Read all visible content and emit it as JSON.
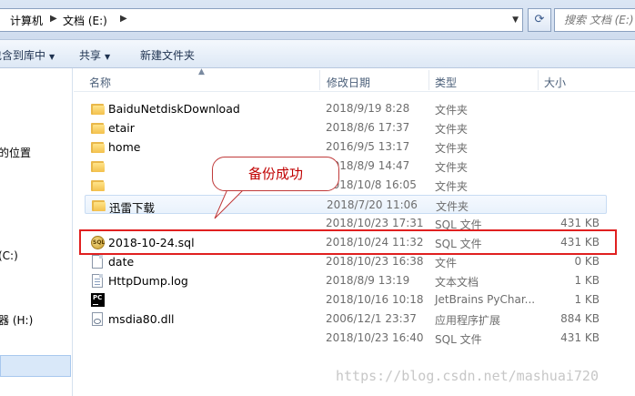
{
  "address": {
    "crumbs": [
      "计算机",
      "文档 (E:)"
    ],
    "search_placeholder": "搜索 文档 (E:)"
  },
  "toolbar": {
    "include_library": "包含到库中",
    "share": "共享",
    "new_folder": "新建文件夹"
  },
  "nav": {
    "items": [
      "的位置",
      "(C:)",
      "器 (H:)"
    ]
  },
  "columns": {
    "name": "名称",
    "date": "修改日期",
    "type": "类型",
    "size": "大小"
  },
  "files": [
    {
      "name": "BaiduNetdiskDownload",
      "date": "2018/9/19 8:28",
      "type": "文件夹",
      "size": "",
      "icon": "folder-icon"
    },
    {
      "name": "etair",
      "date": "2018/8/6 17:37",
      "type": "文件夹",
      "size": "",
      "icon": "folder-icon"
    },
    {
      "name": "home",
      "date": "2016/9/5 13:17",
      "type": "文件夹",
      "size": "",
      "icon": "folder-icon"
    },
    {
      "name": "",
      "date": "2018/8/9 14:47",
      "type": "文件夹",
      "size": "",
      "icon": "folder-icon"
    },
    {
      "name": "",
      "date": "2018/10/8 16:05",
      "type": "文件夹",
      "size": "",
      "icon": "folder-icon"
    },
    {
      "name": "迅雷下载",
      "date": "2018/7/20 11:06",
      "type": "文件夹",
      "size": "",
      "icon": "folder-icon"
    },
    {
      "name": "",
      "date": "2018/10/23 17:31",
      "type": "SQL 文件",
      "size": "431 KB",
      "icon": "sql-file-icon"
    },
    {
      "name": "2018-10-24.sql",
      "date": "2018/10/24 11:32",
      "type": "SQL 文件",
      "size": "431 KB",
      "icon": "sql-file-icon"
    },
    {
      "name": "date",
      "date": "2018/10/23 16:38",
      "type": "文件",
      "size": "0 KB",
      "icon": "blank-file-icon"
    },
    {
      "name": "HttpDump.log",
      "date": "2018/8/9 13:19",
      "type": "文本文档",
      "size": "1 KB",
      "icon": "text-file-icon"
    },
    {
      "name": "",
      "date": "2018/10/16 10:18",
      "type": "JetBrains PyChar...",
      "size": "1 KB",
      "icon": "pycharm-icon"
    },
    {
      "name": "msdia80.dll",
      "date": "2006/12/1 23:37",
      "type": "应用程序扩展",
      "size": "884 KB",
      "icon": "dll-file-icon"
    },
    {
      "name": "",
      "date": "2018/10/23 16:40",
      "type": "SQL 文件",
      "size": "431 KB",
      "icon": "sql-file-icon"
    }
  ],
  "callout": {
    "text": "备份成功"
  },
  "watermark": "https://blog.csdn.net/mashuai720",
  "colors": {
    "highlight": "#e02020",
    "callout_text": "#c00000",
    "selected_bg": "#d9e8f9"
  }
}
